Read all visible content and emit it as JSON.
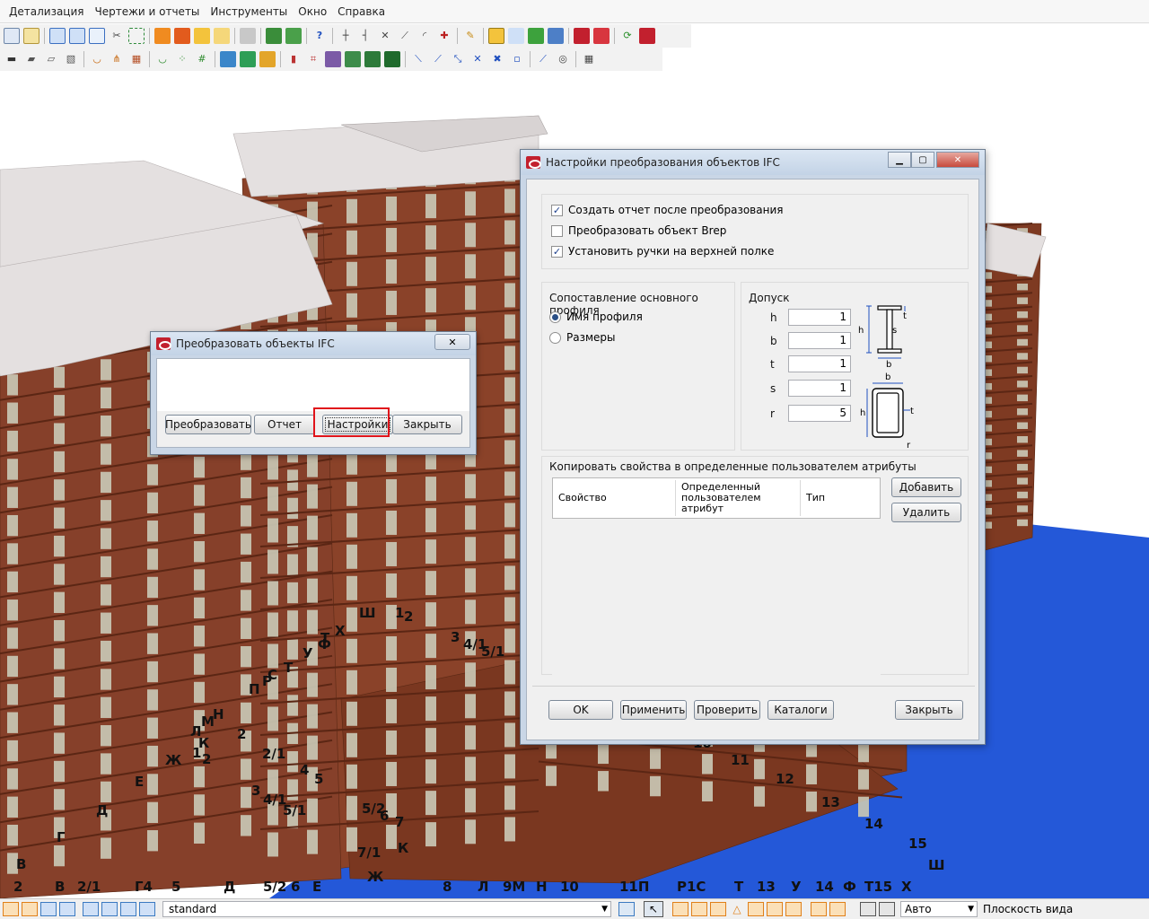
{
  "menubar": {
    "items": [
      "Детализация",
      "Чертежи и отчеты",
      "Инструменты",
      "Окно",
      "Справка"
    ]
  },
  "colors": {
    "facade": "#7e3a22",
    "column": "#c9c7b4",
    "slab": "#e4e0e0",
    "ground": "#2458d8",
    "highlight": "#e0141b",
    "dialog_frame": "#c9d6e6"
  },
  "viewport": {
    "grid_labels": [
      "Ш",
      "1",
      "2",
      "Х",
      "Т",
      "Ф",
      "У",
      "Т",
      "С",
      "Р",
      "П",
      "3",
      "4/1",
      "5/1",
      "Н",
      "М",
      "Л",
      "К",
      "2",
      "Ж",
      "1",
      "2",
      "2/1",
      "4",
      "5",
      "Е",
      "3",
      "4/1",
      "5/1",
      "5/2",
      "6",
      "7",
      "Д",
      "Г",
      "7/1",
      "К",
      "В",
      "Ж",
      "2",
      "В",
      "2/1",
      "Г4",
      "5",
      "Д",
      "5/2",
      "6",
      "Е",
      "8",
      "Л",
      "9М",
      "Н",
      "10",
      "11П",
      "Р1С",
      "Т",
      "13",
      "У",
      "14",
      "Ф",
      "Т15",
      "Х",
      "Ш",
      "15",
      "14",
      "13",
      "12",
      "11",
      "10"
    ]
  },
  "small_dialog": {
    "title": "Преобразовать объекты IFC",
    "close_glyph": "✕",
    "buttons": {
      "convert": "Преобразовать",
      "report": "Отчет",
      "settings": "Настройки",
      "close": "Закрыть"
    }
  },
  "main_dialog": {
    "title": "Настройки преобразования объектов IFC",
    "win_buttons": {
      "minimize": "▁",
      "maximize": "▢",
      "close": "✕"
    },
    "options": [
      {
        "label": "Создать отчет после преобразования",
        "checked": true
      },
      {
        "label": "Преобразовать объект Brep",
        "checked": false
      },
      {
        "label": "Установить ручки на верхней полке",
        "checked": true
      }
    ],
    "profile_mapping": {
      "title": "Сопоставление основного профиля",
      "options": [
        {
          "label": "Имя профиля",
          "selected": true
        },
        {
          "label": "Размеры",
          "selected": false
        }
      ]
    },
    "tolerance": {
      "title": "Допуск",
      "rows": [
        {
          "label": "h",
          "value": "1"
        },
        {
          "label": "b",
          "value": "1"
        },
        {
          "label": "t",
          "value": "1"
        },
        {
          "label": "s",
          "value": "1"
        },
        {
          "label": "r",
          "value": "5"
        }
      ],
      "ibeam_labels": {
        "h": "h",
        "t": "t",
        "s": "s",
        "b": "b"
      },
      "box_labels": {
        "b": "b",
        "h": "h",
        "t": "t",
        "r": "r"
      }
    },
    "copy_props": {
      "title": "Копировать свойства в определенные пользователем атрибуты",
      "columns": [
        "Свойство",
        "Определенный пользователем атрибут",
        "Тип"
      ],
      "add_button": "Добавить",
      "delete_button": "Удалить"
    },
    "footer_buttons": {
      "ok": "OK",
      "apply": "Применить",
      "check": "Проверить",
      "catalogs": "Каталоги",
      "close": "Закрыть"
    }
  },
  "statusbar": {
    "standard": "standard",
    "auto": "Авто",
    "view_plane": "Плоскость вида"
  }
}
